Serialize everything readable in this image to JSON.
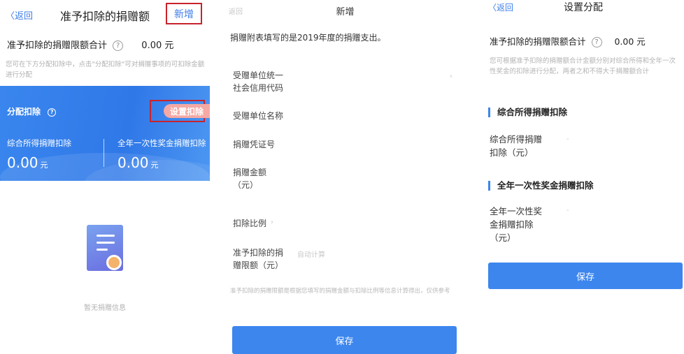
{
  "panel1": {
    "back": "〈返回",
    "title": "准予扣除的捐赠额",
    "add_button": "新增",
    "limit_label": "准予扣除的捐赠限额合计",
    "limit_value": "0.00 元",
    "hint": "您可在下方分配扣除中，点击\"分配扣除\"可对捐赠事项的可扣除金额进行分配",
    "alloc_label": "分配扣除",
    "set_button": "设置扣除",
    "comprehensive_label": "综合所得捐赠扣除",
    "comprehensive_value": "0.00",
    "bonus_label": "全年一次性奖金捐赠扣除",
    "bonus_value": "0.00",
    "unit": "元",
    "empty_text": "暂无捐赠信息"
  },
  "panel2": {
    "back": "返回",
    "title": "新增",
    "notice": "捐赠附表填写的是2019年度的捐赠支出。",
    "fields": [
      {
        "label_1": "受赠单位统一",
        "label_2": "社会信用代码",
        "side": "›"
      },
      {
        "label_1": "受赠单位名称",
        "label_2": ""
      },
      {
        "label_1": "捐赠凭证号",
        "label_2": ""
      },
      {
        "label_1": "捐赠金额",
        "label_2": "（元）"
      },
      {
        "label_1": "扣除比例",
        "label_2": "",
        "side": "›"
      },
      {
        "label_1": "准予扣除的捐",
        "label_2": "赠限额（元）",
        "side": "自动计算"
      }
    ],
    "footnote": "准予扣除的捐赠限额是根据您填写的捐赠金额与扣除比例等信息计算得出，仅供参考",
    "save": "保存"
  },
  "panel3": {
    "back": "〈返回",
    "title": "设置分配",
    "limit_label": "准予扣除的捐赠限额合计",
    "limit_value": "0.00 元",
    "hint": "您可根据准予扣除的捐赠额合计金额分别对综合所得和全年一次性奖金的扣除进行分配，两者之和不得大于捐赠额合计",
    "section1": "综合所得捐赠扣除",
    "field1_line1": "综合所得捐赠",
    "field1_line2": "扣除（元）",
    "section2": "全年一次性奖金捐赠扣除",
    "field2_line1": "全年一次性奖",
    "field2_line2": "金捐赠扣除",
    "field2_line3": "（元）",
    "placeholder": "-",
    "save": "保存"
  },
  "colors": {
    "accent": "#3c86ee",
    "highlight_box": "#c8232c",
    "set_button": "#f4a9a4"
  }
}
